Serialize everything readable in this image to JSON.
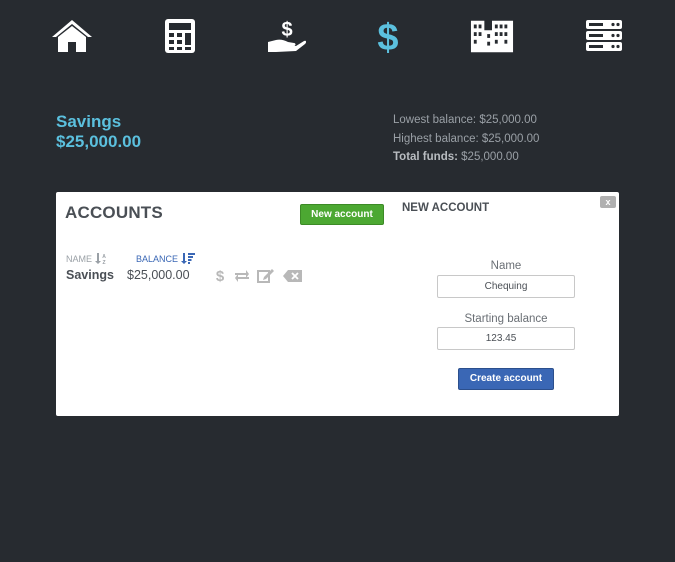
{
  "nav": {
    "items": [
      {
        "name": "home",
        "icon": "home-icon"
      },
      {
        "name": "calculator",
        "icon": "calculator-icon"
      },
      {
        "name": "hand-money",
        "icon": "hand-holding-dollar-icon"
      },
      {
        "name": "accounts",
        "icon": "dollar-icon",
        "active": true
      },
      {
        "name": "buildings",
        "icon": "building-icon"
      },
      {
        "name": "server",
        "icon": "server-icon"
      }
    ],
    "color": "#ffffff",
    "active_color": "#5bc0de"
  },
  "summary": {
    "account_name": "Savings",
    "account_balance": "$25,000.00",
    "lowest_label": "Lowest balance:",
    "lowest_value": "$25,000.00",
    "highest_label": "Highest balance:",
    "highest_value": "$25,000.00",
    "total_label": "Total funds:",
    "total_value": "$25,000.00"
  },
  "accounts_panel": {
    "title": "ACCOUNTS",
    "new_button": "New account",
    "close_label": "x",
    "columns": {
      "name": "NAME",
      "balance": "BALANCE"
    },
    "rows": [
      {
        "name": "Savings",
        "balance": "$25,000.00"
      }
    ],
    "row_actions": [
      "dollar-icon",
      "transfer-icon",
      "edit-icon",
      "delete-icon"
    ]
  },
  "new_account": {
    "title": "NEW ACCOUNT",
    "name_label": "Name",
    "name_value": "Chequing",
    "balance_label": "Starting balance",
    "balance_value": "123.45",
    "submit": "Create account"
  },
  "colors": {
    "background": "#272b30",
    "accent": "#5bc0de",
    "success": "#4ca832",
    "primary": "#3a67b5"
  }
}
